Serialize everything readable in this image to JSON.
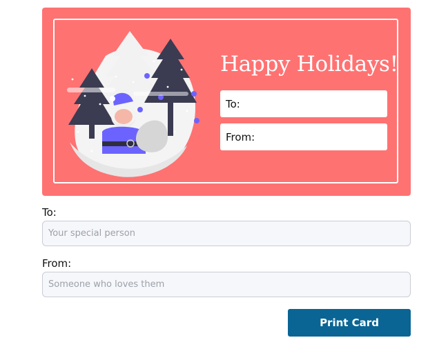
{
  "card": {
    "title": "Happy Holidays!",
    "to_label": "To:",
    "from_label": "From:",
    "background_color": "#ff7272",
    "illustration": "santa-in-snowy-forest-illustration"
  },
  "form": {
    "to_label": "To:",
    "to_placeholder": "Your special person",
    "to_value": "",
    "from_label": "From:",
    "from_placeholder": "Someone who loves them",
    "from_value": ""
  },
  "actions": {
    "print_label": "Print Card",
    "print_color": "#0a6594"
  }
}
